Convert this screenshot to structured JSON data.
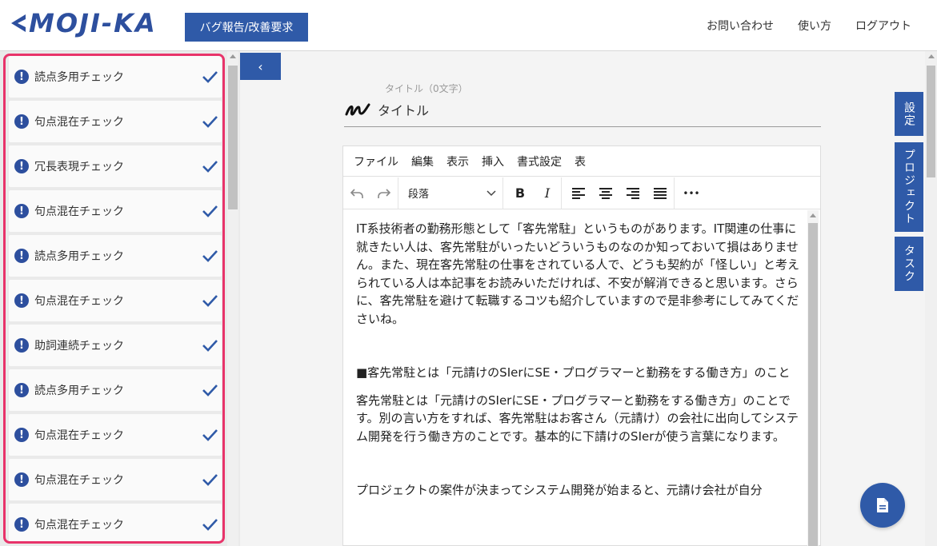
{
  "header": {
    "logo_text": "MOJI-KA",
    "bug_button": "バグ報告/改善要求",
    "nav": [
      "お問い合わせ",
      "使い方",
      "ログアウト"
    ]
  },
  "checks": [
    "読点多用チェック",
    "句点混在チェック",
    "冗長表現チェック",
    "句点混在チェック",
    "読点多用チェック",
    "句点混在チェック",
    "助詞連続チェック",
    "読点多用チェック",
    "句点混在チェック",
    "句点混在チェック",
    "句点混在チェック"
  ],
  "collapse_button": "‹",
  "title": {
    "caption": "タイトル（0文字）",
    "text": "タイトル"
  },
  "editor": {
    "menu": [
      "ファイル",
      "編集",
      "表示",
      "挿入",
      "書式設定",
      "表"
    ],
    "format_select": "段落",
    "bold": "B",
    "italic": "I",
    "more": "•••",
    "paragraphs": [
      "IT系技術者の勤務形態として「客先常駐」というものがあります。IT関連の仕事に就きたい人は、客先常駐がいったいどういうものなのか知っておいて損はありません。また、現在客先常駐の仕事をされている人で、どうも契約が「怪しい」と考えられている人は本記事をお読みいただければ、不安が解消できると思います。さらに、客先常駐を避けて転職するコツも紹介していますので是非参考にしてみてくださいね。",
      "■客先常駐とは「元請けのSIerにSE・プログラマーと勤務をする働き方」のこと",
      "客先常駐とは「元請けのSIerにSE・プログラマーと勤務をする働き方」のことです。別の言い方をすれば、客先常駐はお客さん（元請け）の会社に出向してシステム開発を行う働き方のことです。基本的に下請けのSIerが使う言葉になります。",
      "プロジェクトの案件が決まってシステム開発が始まると、元請け会社が自分"
    ]
  },
  "side_tabs": [
    "設定",
    "プロジェクト",
    "タスク"
  ],
  "colors": {
    "brand": "#2f5aa8",
    "highlight_border": "#e8336a"
  }
}
